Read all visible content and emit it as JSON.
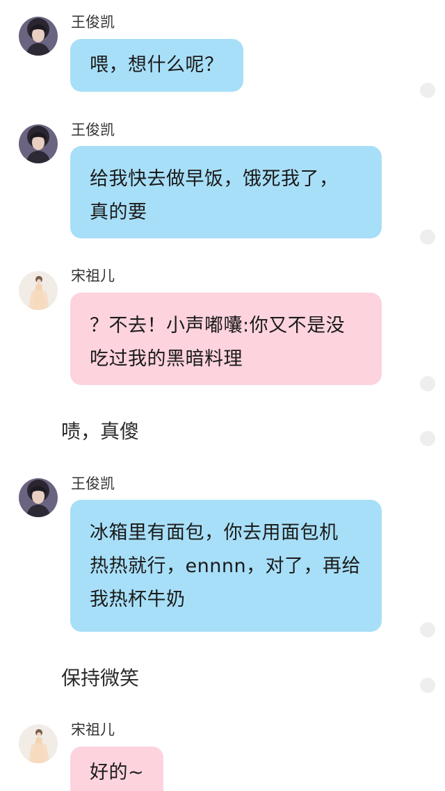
{
  "messages": [
    {
      "type": "message",
      "sender": "王俊凯",
      "text": "喂，想什么呢？"
    },
    {
      "type": "message",
      "sender": "王俊凯",
      "text_lines": [
        "给我快去做早饭，饿死我了，",
        "真的要"
      ]
    },
    {
      "type": "message",
      "sender": "宋祖儿",
      "text_lines": [
        "？不去！小声嘟囔:你又不是没",
        "吃过我的黑暗料理"
      ]
    },
    {
      "type": "narration",
      "text": "啧，真傻"
    },
    {
      "type": "message",
      "sender": "王俊凯",
      "text_lines": [
        "冰箱里有面包，你去用面包机",
        "热热就行，ennnn，对了，再给",
        "我热杯牛奶"
      ]
    },
    {
      "type": "narration",
      "text": "保持微笑"
    },
    {
      "type": "message",
      "sender": "宋祖儿",
      "text": "好的~"
    }
  ],
  "colors": {
    "boy_bubble": "#a8dff8",
    "girl_bubble": "#fdd3de",
    "status_dot": "#eeeeee"
  },
  "icons": {
    "boy_avatar": "boy-avatar-icon",
    "girl_avatar": "girl-avatar-icon",
    "status_dot": "status-dot-icon"
  }
}
